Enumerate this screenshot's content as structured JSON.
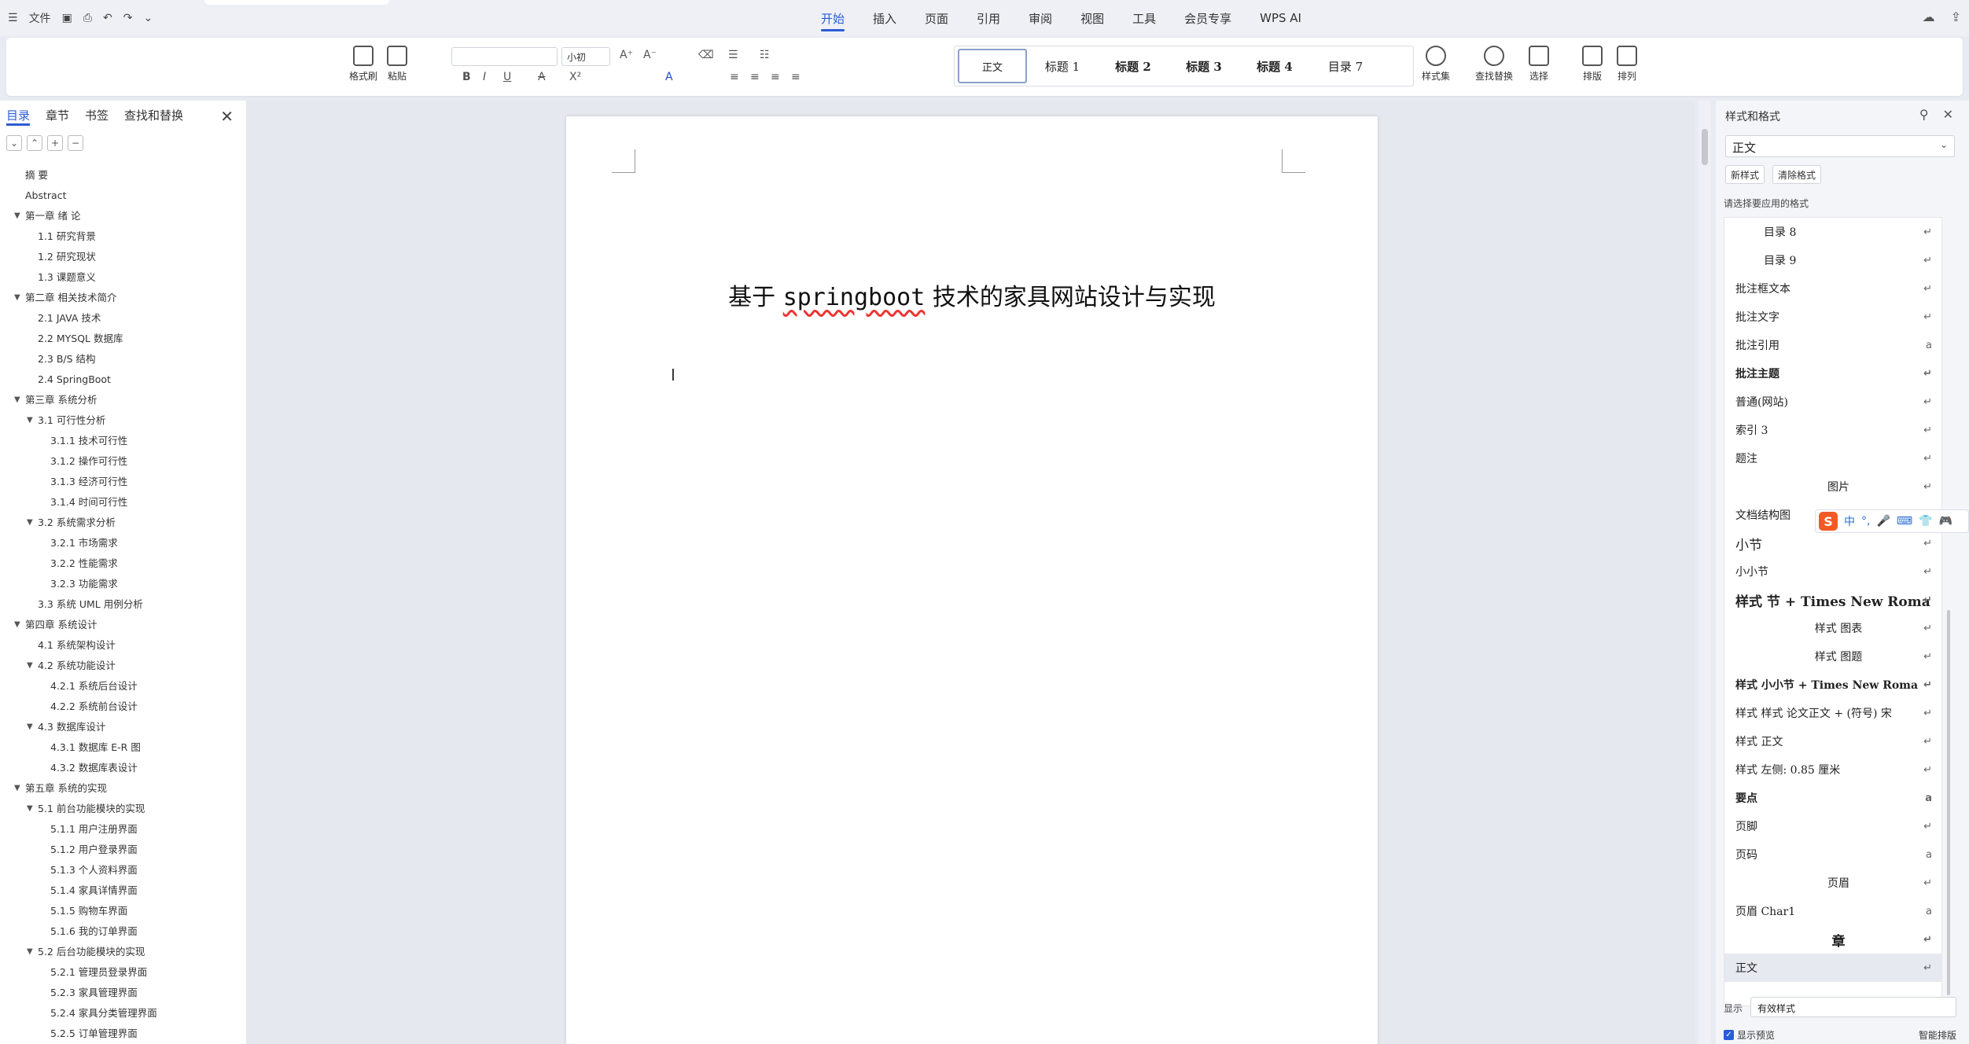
{
  "topbar": {
    "file_label": "文件",
    "menu": [
      "开始",
      "插入",
      "页面",
      "引用",
      "审阅",
      "视图",
      "工具",
      "会员专享",
      "WPS AI"
    ]
  },
  "ribbon": {
    "format_painter": "格式刷",
    "paste": "粘贴",
    "font_size": "小初",
    "styles": [
      "正文",
      "标题 1",
      "标题 2",
      "标题 3",
      "标题 4",
      "目录 7"
    ],
    "style_set": "样式集",
    "find_replace": "查找替换",
    "select": "选择",
    "layout": "排版",
    "arrange": "排列"
  },
  "nav": {
    "tabs": [
      "目录",
      "章节",
      "书签",
      "查找和替换"
    ],
    "toc": [
      {
        "text": "摘 要",
        "level": 0
      },
      {
        "text": "Abstract",
        "level": 0
      },
      {
        "text": "第一章 绪 论",
        "level": 0,
        "caret": true
      },
      {
        "text": "1.1 研究背景",
        "level": 1
      },
      {
        "text": "1.2 研究现状",
        "level": 1
      },
      {
        "text": "1.3 课题意义",
        "level": 1
      },
      {
        "text": "第二章 相关技术简介",
        "level": 0,
        "caret": true
      },
      {
        "text": "2.1 JAVA 技术",
        "level": 1
      },
      {
        "text": "2.2 MYSQL 数据库",
        "level": 1
      },
      {
        "text": "2.3 B/S 结构",
        "level": 1
      },
      {
        "text": "2.4 SpringBoot",
        "level": 1
      },
      {
        "text": "第三章 系统分析",
        "level": 0,
        "caret": true
      },
      {
        "text": "3.1 可行性分析",
        "level": 1,
        "caret": true
      },
      {
        "text": "3.1.1 技术可行性",
        "level": 2
      },
      {
        "text": "3.1.2 操作可行性",
        "level": 2
      },
      {
        "text": "3.1.3 经济可行性",
        "level": 2
      },
      {
        "text": "3.1.4 时间可行性",
        "level": 2
      },
      {
        "text": "3.2 系统需求分析",
        "level": 1,
        "caret": true
      },
      {
        "text": "3.2.1 市场需求",
        "level": 2
      },
      {
        "text": "3.2.2 性能需求",
        "level": 2
      },
      {
        "text": "3.2.3 功能需求",
        "level": 2
      },
      {
        "text": "3.3 系统 UML 用例分析",
        "level": 1
      },
      {
        "text": "第四章 系统设计",
        "level": 0,
        "caret": true
      },
      {
        "text": "4.1 系统架构设计",
        "level": 1
      },
      {
        "text": "4.2 系统功能设计",
        "level": 1,
        "caret": true
      },
      {
        "text": "4.2.1 系统后台设计",
        "level": 2
      },
      {
        "text": "4.2.2 系统前台设计",
        "level": 2
      },
      {
        "text": "4.3 数据库设计",
        "level": 1,
        "caret": true
      },
      {
        "text": "4.3.1 数据库 E-R 图",
        "level": 2
      },
      {
        "text": "4.3.2 数据库表设计",
        "level": 2
      },
      {
        "text": "第五章 系统的实现",
        "level": 0,
        "caret": true
      },
      {
        "text": "5.1 前台功能模块的实现",
        "level": 1,
        "caret": true
      },
      {
        "text": "5.1.1 用户注册界面",
        "level": 2
      },
      {
        "text": "5.1.2 用户登录界面",
        "level": 2
      },
      {
        "text": "5.1.3 个人资料界面",
        "level": 2
      },
      {
        "text": "5.1.4 家具详情界面",
        "level": 2
      },
      {
        "text": "5.1.5 购物车界面",
        "level": 2
      },
      {
        "text": "5.1.6 我的订单界面",
        "level": 2
      },
      {
        "text": "5.2 后台功能模块的实现",
        "level": 1,
        "caret": true
      },
      {
        "text": "5.2.1 管理员登录界面",
        "level": 2
      },
      {
        "text": "5.2.3 家具管理界面",
        "level": 2
      },
      {
        "text": "5.2.4 家具分类管理界面",
        "level": 2
      },
      {
        "text": "5.2.5 订单管理界面",
        "level": 2
      }
    ]
  },
  "document": {
    "title_prefix": "基于 ",
    "title_en": "springboot",
    "title_suffix": " 技术的家具网站设计与实现"
  },
  "styles_panel": {
    "title": "样式和格式",
    "current": "正文",
    "new_style": "新样式",
    "clear_format": "清除格式",
    "hint": "请选择要应用的格式",
    "items": [
      {
        "text": "目录 8",
        "mark": "↵",
        "indent": 1
      },
      {
        "text": "目录 9",
        "mark": "↵",
        "indent": 1
      },
      {
        "text": "批注框文本",
        "mark": "↵"
      },
      {
        "text": "批注文字",
        "mark": "↵"
      },
      {
        "text": "批注引用",
        "mark": "a"
      },
      {
        "text": "批注主题",
        "mark": "↵",
        "bold": true
      },
      {
        "text": "普通(网站)",
        "mark": "↵"
      },
      {
        "text": "索引 3",
        "mark": "↵"
      },
      {
        "text": "题注",
        "mark": "↵"
      },
      {
        "text": "图片",
        "mark": "↵",
        "center": true
      },
      {
        "text": "文档结构图",
        "mark": ""
      },
      {
        "text": "小节",
        "mark": "↵",
        "big": true
      },
      {
        "text": "小小节",
        "mark": "↵"
      },
      {
        "text": "样式 节 + Times New Roma",
        "mark": "↵",
        "bold": true,
        "big": true
      },
      {
        "text": "样式 图表",
        "mark": "↵",
        "center": true
      },
      {
        "text": "样式 图题",
        "mark": "↵",
        "center": true
      },
      {
        "text": "样式 小小节 + Times New Roma",
        "mark": "↵",
        "bold": true
      },
      {
        "text": "样式 样式 论文正文 + (符号) 宋",
        "mark": "↵"
      },
      {
        "text": "样式 正文",
        "mark": "↵"
      },
      {
        "text": "样式 左侧: 0.85 厘米",
        "mark": "↵"
      },
      {
        "text": "要点",
        "mark": "a",
        "bold": true
      },
      {
        "text": "页脚",
        "mark": "↵"
      },
      {
        "text": "页码",
        "mark": "a"
      },
      {
        "text": "页眉",
        "mark": "↵",
        "center": true
      },
      {
        "text": "页眉 Char1",
        "mark": "a"
      },
      {
        "text": "章",
        "mark": "↵",
        "center": true,
        "bold": true,
        "big": true
      },
      {
        "text": "正文",
        "mark": "↵",
        "selected": true
      }
    ],
    "show_label": "显示",
    "show_value": "有效样式",
    "preview_label": "显示预览",
    "smart_layout": "智能排版"
  },
  "ime": {
    "lang": "中"
  }
}
